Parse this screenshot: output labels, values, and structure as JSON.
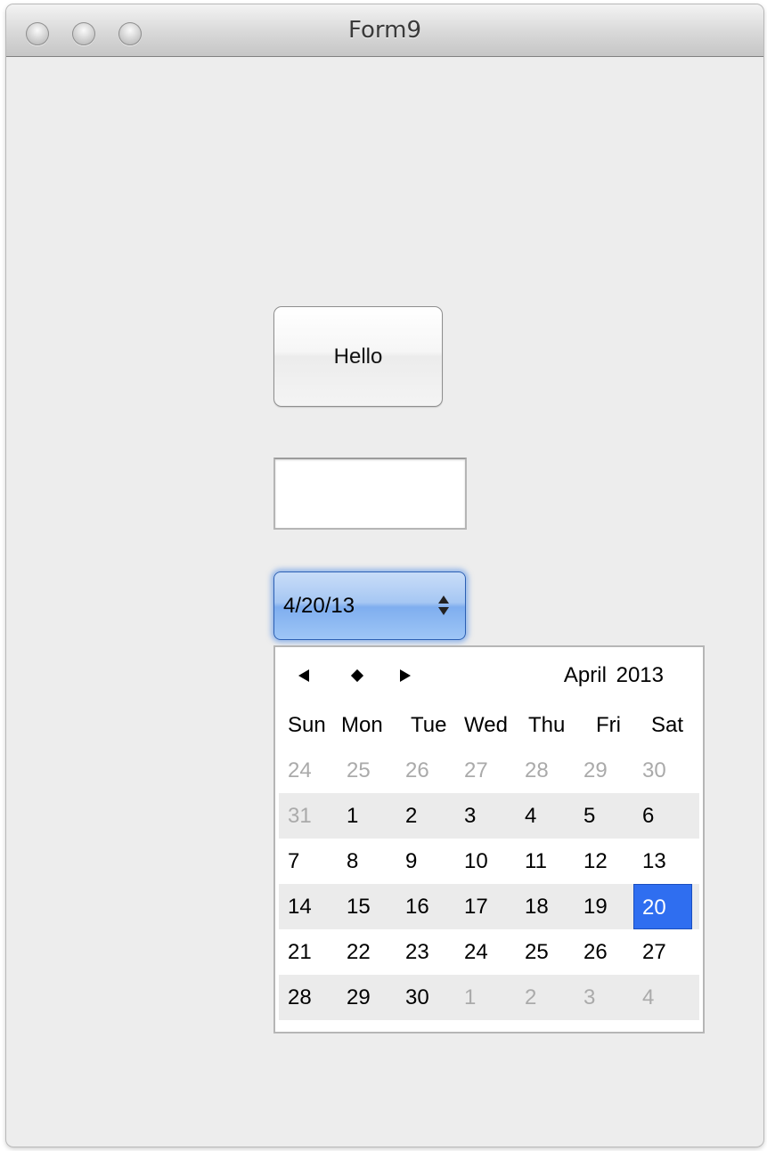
{
  "window": {
    "title": "Form9"
  },
  "button": {
    "label": "Hello"
  },
  "text_field": {
    "value": ""
  },
  "date_edit": {
    "value": "4/20/13"
  },
  "calendar": {
    "month_year": "April  2013",
    "weekdays": [
      "Sun",
      "Mon",
      "Tue",
      "Wed",
      "Thu",
      "Fri",
      "Sat"
    ],
    "weeks": [
      [
        [
          "24",
          false
        ],
        [
          "25",
          false
        ],
        [
          "26",
          false
        ],
        [
          "27",
          false
        ],
        [
          "28",
          false
        ],
        [
          "29",
          false
        ],
        [
          "30",
          false
        ]
      ],
      [
        [
          "31",
          false
        ],
        [
          "1",
          true
        ],
        [
          "2",
          true
        ],
        [
          "3",
          true
        ],
        [
          "4",
          true
        ],
        [
          "5",
          true
        ],
        [
          "6",
          true
        ]
      ],
      [
        [
          "7",
          true
        ],
        [
          "8",
          true
        ],
        [
          "9",
          true
        ],
        [
          "10",
          true
        ],
        [
          "11",
          true
        ],
        [
          "12",
          true
        ],
        [
          "13",
          true
        ]
      ],
      [
        [
          "14",
          true
        ],
        [
          "15",
          true
        ],
        [
          "16",
          true
        ],
        [
          "17",
          true
        ],
        [
          "18",
          true
        ],
        [
          "19",
          true
        ],
        [
          "20",
          true
        ]
      ],
      [
        [
          "21",
          true
        ],
        [
          "22",
          true
        ],
        [
          "23",
          true
        ],
        [
          "24",
          true
        ],
        [
          "25",
          true
        ],
        [
          "26",
          true
        ],
        [
          "27",
          true
        ]
      ],
      [
        [
          "28",
          true
        ],
        [
          "29",
          true
        ],
        [
          "30",
          true
        ],
        [
          "1",
          false
        ],
        [
          "2",
          false
        ],
        [
          "3",
          false
        ],
        [
          "4",
          false
        ]
      ]
    ],
    "selected_day": "20",
    "selected_color": "#2f6ef0",
    "icons": {
      "prev": "triangle-left-icon",
      "today": "diamond-icon",
      "next": "triangle-right-icon"
    }
  }
}
